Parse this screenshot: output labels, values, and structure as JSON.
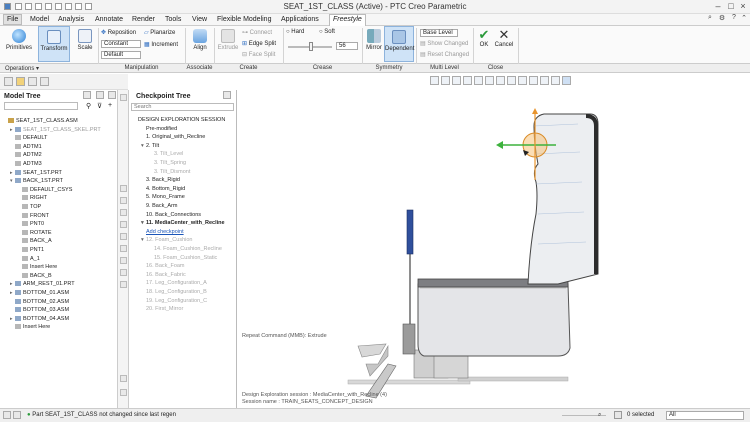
{
  "window": {
    "title": "SEAT_1ST_CLASS (Active) - PTC Creo Parametric"
  },
  "menu": {
    "tabs": [
      "File",
      "Model",
      "Analysis",
      "Annotate",
      "Render",
      "Tools",
      "View",
      "Flexible Modeling",
      "Applications",
      "Freestyle"
    ],
    "active": "Freestyle"
  },
  "ribbon": {
    "primitives": "Primitives",
    "transform": "Transform",
    "scale": "Scale",
    "reposition": "Reposition",
    "planarize": "Planarize",
    "constant": "Constant",
    "increment": "Increment",
    "default": "Default",
    "align": "Align",
    "extrude": "Extrude",
    "connect": "Connect",
    "edge_split": "Edge Split",
    "face_split": "Face Split",
    "hard": "Hard",
    "soft": "Soft",
    "crease_value": "56",
    "mirror": "Mirror",
    "dependent": "Dependent",
    "base_level": "Base Level",
    "show_changed": "Show Changed",
    "reset_changed": "Reset Changed",
    "ok": "OK",
    "cancel": "Cancel"
  },
  "groups": [
    "Operations",
    "Manipulation",
    "Associate",
    "Create",
    "Crease",
    "Symmetry",
    "Multi Level",
    "Close"
  ],
  "model_tree": {
    "title": "Model Tree",
    "nodes": [
      {
        "label": "SEAT_1ST_CLASS.ASM",
        "level": 0,
        "gray": false,
        "exp": ""
      },
      {
        "label": "SEAT_1ST_CLASS_SKEL.PRT",
        "level": 1,
        "gray": true,
        "exp": "▸"
      },
      {
        "label": "DEFAULT",
        "level": 1,
        "gray": false,
        "exp": ""
      },
      {
        "label": "ADTM1",
        "level": 1,
        "gray": false,
        "exp": ""
      },
      {
        "label": "ADTM2",
        "level": 1,
        "gray": false,
        "exp": ""
      },
      {
        "label": "ADTM3",
        "level": 1,
        "gray": false,
        "exp": ""
      },
      {
        "label": "SEAT_1ST.PRT",
        "level": 1,
        "gray": false,
        "exp": "▸"
      },
      {
        "label": "BACK_1ST.PRT",
        "level": 1,
        "gray": false,
        "exp": "▾"
      },
      {
        "label": "DEFAULT_CSYS",
        "level": 2,
        "gray": false,
        "exp": ""
      },
      {
        "label": "RIGHT",
        "level": 2,
        "gray": false,
        "exp": ""
      },
      {
        "label": "TOP",
        "level": 2,
        "gray": false,
        "exp": ""
      },
      {
        "label": "FRONT",
        "level": 2,
        "gray": false,
        "exp": ""
      },
      {
        "label": "PNT0",
        "level": 2,
        "gray": false,
        "exp": ""
      },
      {
        "label": "ROTATE",
        "level": 2,
        "gray": false,
        "exp": ""
      },
      {
        "label": "BACK_A",
        "level": 2,
        "gray": false,
        "exp": ""
      },
      {
        "label": "PNT1",
        "level": 2,
        "gray": false,
        "exp": ""
      },
      {
        "label": "A_1",
        "level": 2,
        "gray": false,
        "exp": ""
      },
      {
        "label": "Insert Here",
        "level": 2,
        "gray": false,
        "exp": ""
      },
      {
        "label": "BACK_B",
        "level": 2,
        "gray": false,
        "exp": ""
      },
      {
        "label": "ARM_REST_01.PRT",
        "level": 1,
        "gray": false,
        "exp": "▸"
      },
      {
        "label": "BOTTOM_01.ASM",
        "level": 1,
        "gray": false,
        "exp": "▸"
      },
      {
        "label": "BOTTOM_02.ASM",
        "level": 1,
        "gray": false,
        "exp": ""
      },
      {
        "label": "BOTTOM_03.ASM",
        "level": 1,
        "gray": false,
        "exp": ""
      },
      {
        "label": "BOTTOM_04.ASM",
        "level": 1,
        "gray": false,
        "exp": "▸"
      },
      {
        "label": "Insert Here",
        "level": 1,
        "gray": false,
        "exp": ""
      }
    ]
  },
  "checkpoint_tree": {
    "title": "Checkpoint Tree",
    "search_placeholder": "Search",
    "items": [
      {
        "label": "DESIGN EXPLORATION SESSION",
        "indent": 0,
        "style": "normal",
        "exp": ""
      },
      {
        "label": "Pre-modified",
        "indent": 1,
        "style": "normal",
        "exp": ""
      },
      {
        "label": "1. Original_with_Recline",
        "indent": 1,
        "style": "normal",
        "exp": ""
      },
      {
        "label": "2. Tilt",
        "indent": 1,
        "style": "normal",
        "exp": "▾"
      },
      {
        "label": "3. Tilt_Level",
        "indent": 2,
        "style": "gray",
        "exp": ""
      },
      {
        "label": "3. Tilt_Spring",
        "indent": 2,
        "style": "gray",
        "exp": ""
      },
      {
        "label": "3. Tilt_Dismont",
        "indent": 2,
        "style": "gray",
        "exp": ""
      },
      {
        "label": "3. Back_Rigid",
        "indent": 1,
        "style": "normal",
        "exp": ""
      },
      {
        "label": "4. Bottom_Rigid",
        "indent": 1,
        "style": "normal",
        "exp": ""
      },
      {
        "label": "5. Mono_Frame",
        "indent": 1,
        "style": "normal",
        "exp": ""
      },
      {
        "label": "9. Back_Arm",
        "indent": 1,
        "style": "normal",
        "exp": ""
      },
      {
        "label": "10. Back_Connections",
        "indent": 1,
        "style": "normal",
        "exp": ""
      },
      {
        "label": "11. MediaCenter_with_Recline",
        "indent": 1,
        "style": "bold",
        "exp": "▾"
      },
      {
        "label": "Add checkpoint",
        "indent": 1,
        "style": "link",
        "exp": ""
      },
      {
        "label": "12. Foam_Cushion",
        "indent": 1,
        "style": "gray",
        "exp": "▾"
      },
      {
        "label": "14. Foam_Cushion_Recline",
        "indent": 2,
        "style": "gray",
        "exp": ""
      },
      {
        "label": "15. Foam_Cushion_Static",
        "indent": 2,
        "style": "gray",
        "exp": ""
      },
      {
        "label": "16. Back_Foam",
        "indent": 1,
        "style": "gray",
        "exp": ""
      },
      {
        "label": "16. Back_Fabric",
        "indent": 1,
        "style": "gray",
        "exp": ""
      },
      {
        "label": "17. Leg_Configuration_A",
        "indent": 1,
        "style": "gray",
        "exp": ""
      },
      {
        "label": "18. Leg_Configuration_B",
        "indent": 1,
        "style": "gray",
        "exp": ""
      },
      {
        "label": "19. Leg_Configuration_C",
        "indent": 1,
        "style": "gray",
        "exp": ""
      },
      {
        "label": "20. First_Mirror",
        "indent": 1,
        "style": "gray",
        "exp": ""
      }
    ]
  },
  "graphics": {
    "repeat_text": "Repeat Command (MMB): Extrude",
    "session_line1": "Design Exploration session : MediaCenter_with_Recline (4)",
    "session_line2": "Session name : TRAIN_SEATS_CONCEPT_DESIGN"
  },
  "status": {
    "message": "Part SEAT_1ST_CLASS not changed since last regen",
    "selected": "0 selected",
    "filter": "All"
  },
  "colors": {
    "accent": "#1f6fc5",
    "ok_green": "#2b9a3b",
    "seat_blue": "#3c5aa8",
    "dragger_orange": "#f0a040"
  }
}
